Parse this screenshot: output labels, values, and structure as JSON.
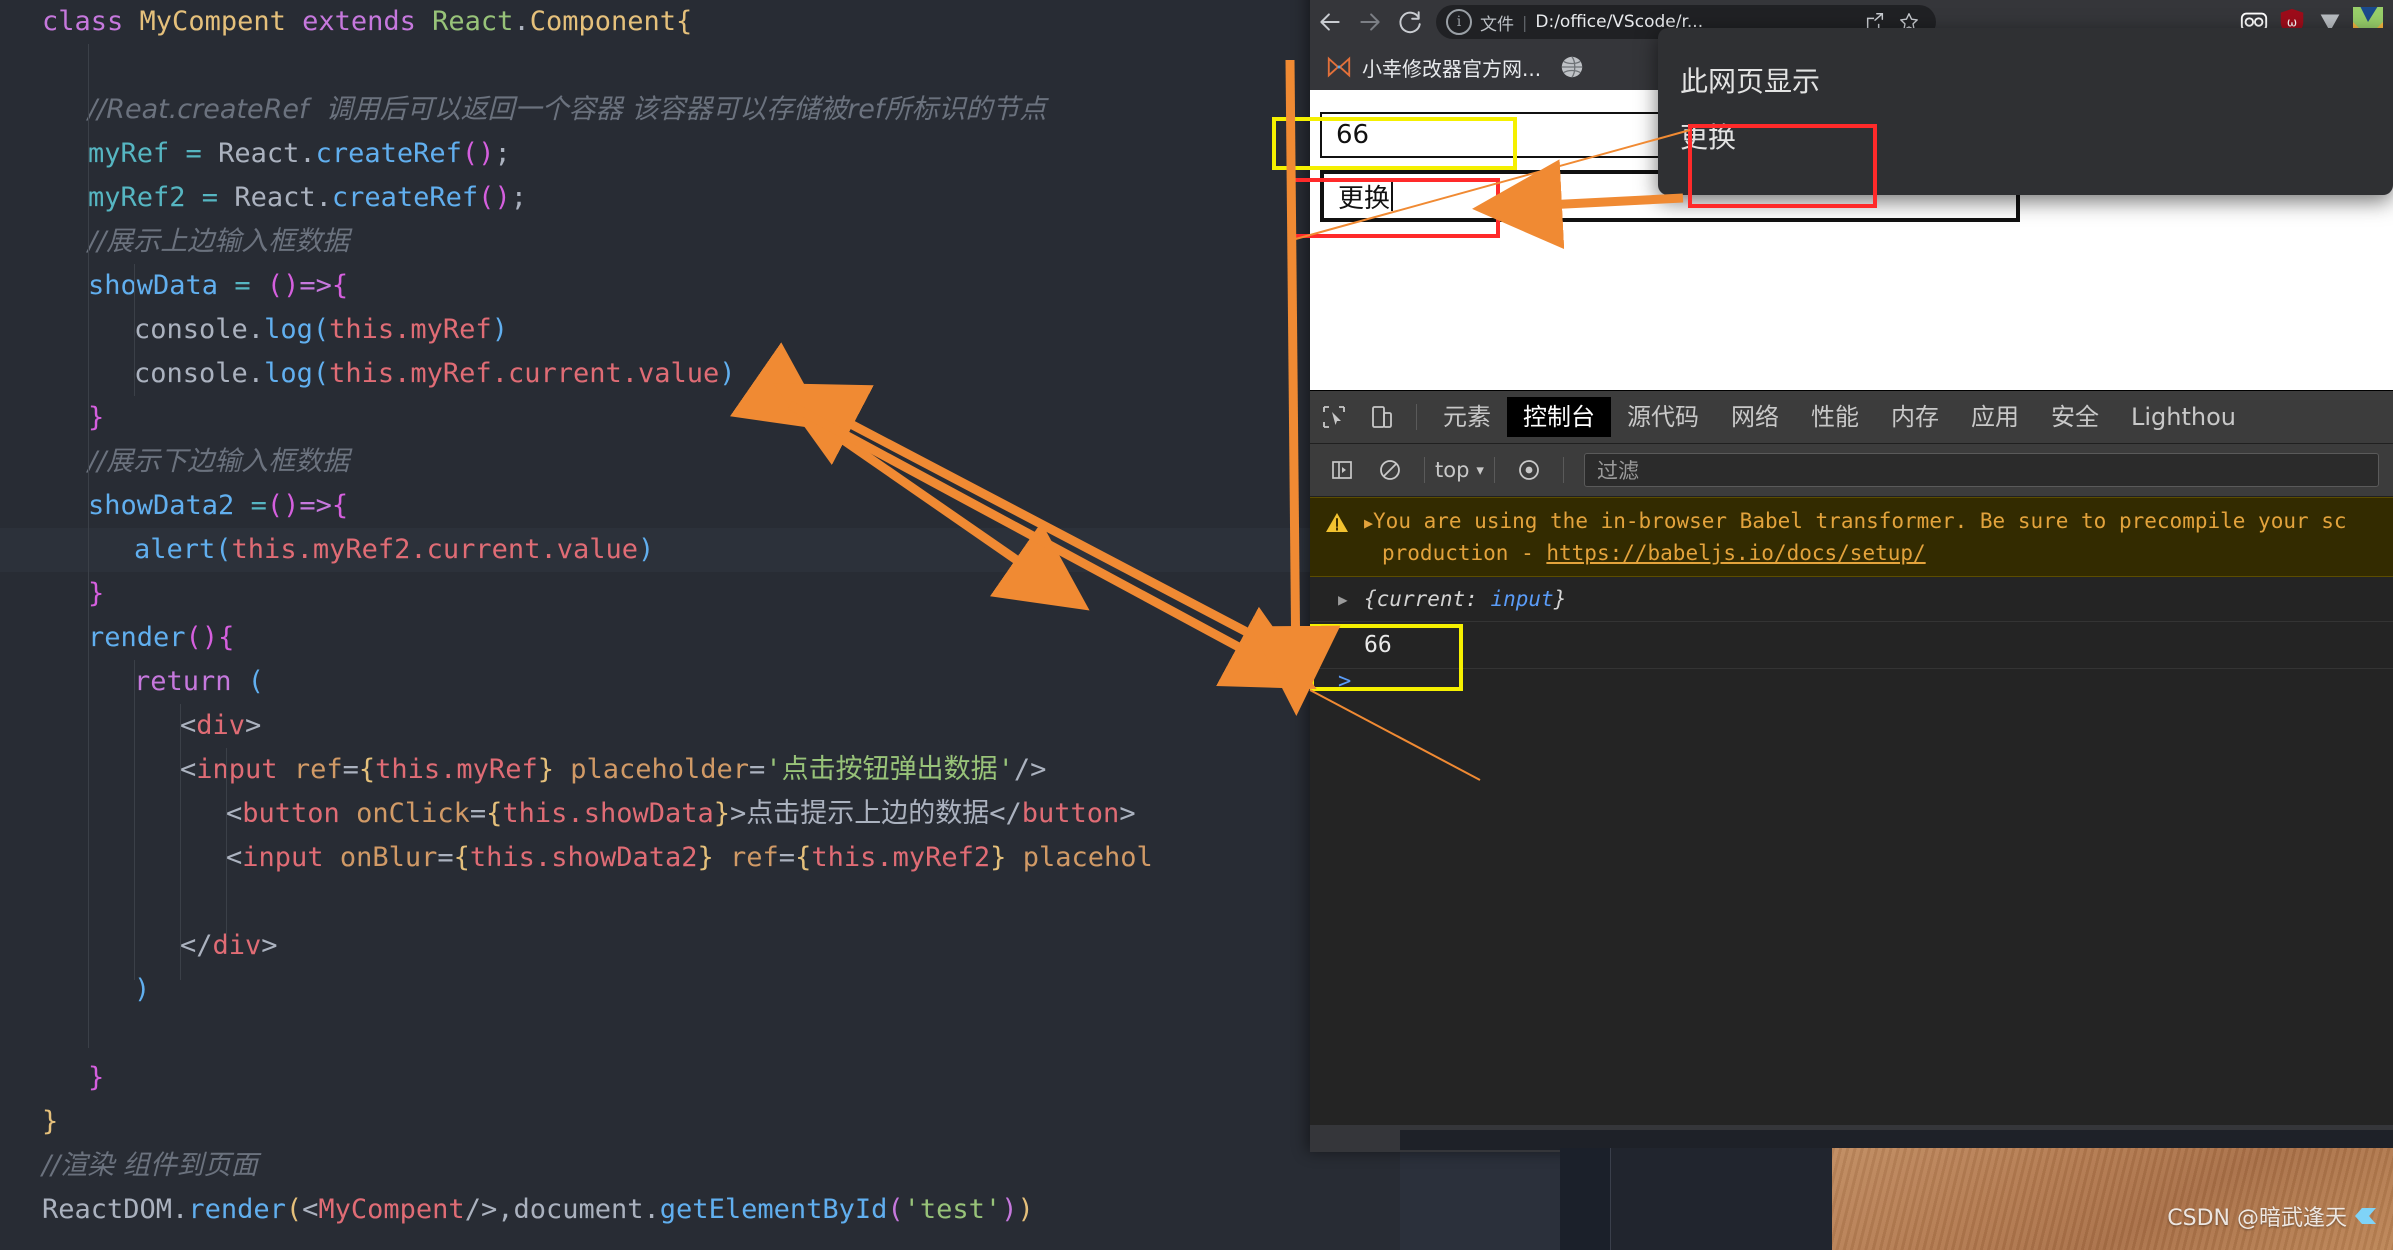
{
  "editor": {
    "lines": [
      {
        "indent": 0,
        "tokens": [
          {
            "t": "class ",
            "c": "k"
          },
          {
            "t": "MyCompent ",
            "c": "yel"
          },
          {
            "t": "extends ",
            "c": "k"
          },
          {
            "t": "React",
            "c": "str"
          },
          {
            "t": ".",
            "c": "gry"
          },
          {
            "t": "Component",
            "c": "yel"
          },
          {
            "t": "{",
            "c": "yel"
          }
        ]
      },
      {
        "indent": 0,
        "tokens": []
      },
      {
        "indent": 1,
        "tokens": [
          {
            "t": "//Reat.createRef  调用后可以返回一个容器 该容器可以存储被ref所标识的节点",
            "c": "cmt-cn"
          }
        ]
      },
      {
        "indent": 1,
        "tokens": [
          {
            "t": "myRef ",
            "c": "cyan"
          },
          {
            "t": "= ",
            "c": "prop"
          },
          {
            "t": "React",
            "c": "var"
          },
          {
            "t": ".",
            "c": "gry"
          },
          {
            "t": "createRef",
            "c": "blue"
          },
          {
            "t": "(",
            "c": "pink"
          },
          {
            "t": ")",
            "c": "pink"
          },
          {
            "t": ";",
            "c": "gry"
          }
        ]
      },
      {
        "indent": 1,
        "tokens": [
          {
            "t": "myRef2 ",
            "c": "cyan"
          },
          {
            "t": "= ",
            "c": "prop"
          },
          {
            "t": "React",
            "c": "var"
          },
          {
            "t": ".",
            "c": "gry"
          },
          {
            "t": "createRef",
            "c": "blue"
          },
          {
            "t": "(",
            "c": "pink"
          },
          {
            "t": ")",
            "c": "pink"
          },
          {
            "t": ";",
            "c": "gry"
          }
        ]
      },
      {
        "indent": 1,
        "tokens": [
          {
            "t": "//展示上边输入框数据",
            "c": "cmt-cn"
          }
        ]
      },
      {
        "indent": 1,
        "tokens": [
          {
            "t": "showData ",
            "c": "blue"
          },
          {
            "t": "= ",
            "c": "prop"
          },
          {
            "t": "(",
            "c": "pink"
          },
          {
            "t": ")",
            "c": "pink"
          },
          {
            "t": "=>",
            "c": "mag"
          },
          {
            "t": "{",
            "c": "pink"
          }
        ]
      },
      {
        "indent": 2,
        "tokens": [
          {
            "t": "console",
            "c": "gry"
          },
          {
            "t": ".",
            "c": "gry"
          },
          {
            "t": "log",
            "c": "blue"
          },
          {
            "t": "(",
            "c": "blue"
          },
          {
            "t": "this",
            "c": "red"
          },
          {
            "t": ".",
            "c": "red"
          },
          {
            "t": "myRef",
            "c": "red"
          },
          {
            "t": ")",
            "c": "blue"
          }
        ]
      },
      {
        "indent": 2,
        "tokens": [
          {
            "t": "console",
            "c": "gry"
          },
          {
            "t": ".",
            "c": "gry"
          },
          {
            "t": "log",
            "c": "blue"
          },
          {
            "t": "(",
            "c": "blue"
          },
          {
            "t": "this",
            "c": "red"
          },
          {
            "t": ".",
            "c": "red"
          },
          {
            "t": "myRef",
            "c": "red"
          },
          {
            "t": ".",
            "c": "red"
          },
          {
            "t": "current",
            "c": "red"
          },
          {
            "t": ".",
            "c": "red"
          },
          {
            "t": "value",
            "c": "red"
          },
          {
            "t": ")",
            "c": "blue"
          }
        ]
      },
      {
        "indent": 1,
        "tokens": [
          {
            "t": "}",
            "c": "pink"
          }
        ]
      },
      {
        "indent": 1,
        "tokens": [
          {
            "t": "//展示下边输入框数据",
            "c": "cmt-cn"
          }
        ]
      },
      {
        "indent": 1,
        "tokens": [
          {
            "t": "showData2 ",
            "c": "blue"
          },
          {
            "t": "=",
            "c": "prop"
          },
          {
            "t": "(",
            "c": "pink"
          },
          {
            "t": ")",
            "c": "pink"
          },
          {
            "t": "=>",
            "c": "mag"
          },
          {
            "t": "{",
            "c": "pink"
          }
        ]
      },
      {
        "indent": 2,
        "hl": true,
        "tokens": [
          {
            "t": "alert",
            "c": "blue"
          },
          {
            "t": "(",
            "c": "blue"
          },
          {
            "t": "this",
            "c": "red"
          },
          {
            "t": ".",
            "c": "red"
          },
          {
            "t": "myRef2",
            "c": "red"
          },
          {
            "t": ".",
            "c": "red"
          },
          {
            "t": "current",
            "c": "red"
          },
          {
            "t": ".",
            "c": "red"
          },
          {
            "t": "value",
            "c": "red"
          },
          {
            "t": ")",
            "c": "blue"
          }
        ]
      },
      {
        "indent": 1,
        "tokens": [
          {
            "t": "}",
            "c": "pink"
          }
        ]
      },
      {
        "indent": 1,
        "tokens": [
          {
            "t": "render",
            "c": "blue"
          },
          {
            "t": "(",
            "c": "pink"
          },
          {
            "t": ")",
            "c": "pink"
          },
          {
            "t": "{",
            "c": "pink"
          }
        ]
      },
      {
        "indent": 2,
        "tokens": [
          {
            "t": "return ",
            "c": "mag"
          },
          {
            "t": "(",
            "c": "blue"
          }
        ]
      },
      {
        "indent": 3,
        "tokens": [
          {
            "t": "<",
            "c": "gry"
          },
          {
            "t": "div",
            "c": "red"
          },
          {
            "t": ">",
            "c": "gry"
          }
        ]
      },
      {
        "indent": 3,
        "tokens": [
          {
            "t": "<",
            "c": "gry"
          },
          {
            "t": "input ",
            "c": "red"
          },
          {
            "t": "ref",
            "c": "org"
          },
          {
            "t": "=",
            "c": "gry"
          },
          {
            "t": "{",
            "c": "yel"
          },
          {
            "t": "this",
            "c": "red"
          },
          {
            "t": ".",
            "c": "red"
          },
          {
            "t": "myRef",
            "c": "red"
          },
          {
            "t": "}",
            "c": "yel"
          },
          {
            "t": " placeholder",
            "c": "org"
          },
          {
            "t": "=",
            "c": "gry"
          },
          {
            "t": "'",
            "c": "str"
          },
          {
            "t": "点击按钮弹出数据",
            "c": "cnstr"
          },
          {
            "t": "'",
            "c": "str"
          },
          {
            "t": "/>",
            "c": "gry"
          }
        ]
      },
      {
        "indent": 4,
        "tokens": [
          {
            "t": "<",
            "c": "gry"
          },
          {
            "t": "button ",
            "c": "red"
          },
          {
            "t": "onClick",
            "c": "org"
          },
          {
            "t": "=",
            "c": "gry"
          },
          {
            "t": "{",
            "c": "yel"
          },
          {
            "t": "this",
            "c": "red"
          },
          {
            "t": ".",
            "c": "red"
          },
          {
            "t": "showData",
            "c": "red"
          },
          {
            "t": "}",
            "c": "yel"
          },
          {
            "t": ">",
            "c": "gry"
          },
          {
            "t": "点击提示上边的数据",
            "c": "cn"
          },
          {
            "t": "</",
            "c": "gry"
          },
          {
            "t": "button",
            "c": "red"
          },
          {
            "t": ">",
            "c": "gry"
          }
        ]
      },
      {
        "indent": 4,
        "tokens": [
          {
            "t": "<",
            "c": "gry"
          },
          {
            "t": "input ",
            "c": "red"
          },
          {
            "t": "onBlur",
            "c": "org"
          },
          {
            "t": "=",
            "c": "gry"
          },
          {
            "t": "{",
            "c": "yel"
          },
          {
            "t": "this",
            "c": "red"
          },
          {
            "t": ".",
            "c": "red"
          },
          {
            "t": "showData2",
            "c": "red"
          },
          {
            "t": "}",
            "c": "yel"
          },
          {
            "t": " ref",
            "c": "org"
          },
          {
            "t": "=",
            "c": "gry"
          },
          {
            "t": "{",
            "c": "yel"
          },
          {
            "t": "this",
            "c": "red"
          },
          {
            "t": ".",
            "c": "red"
          },
          {
            "t": "myRef2",
            "c": "red"
          },
          {
            "t": "}",
            "c": "yel"
          },
          {
            "t": " placehol",
            "c": "org"
          }
        ]
      },
      {
        "indent": 0,
        "tokens": []
      },
      {
        "indent": 3,
        "tokens": [
          {
            "t": "</",
            "c": "gry"
          },
          {
            "t": "div",
            "c": "red"
          },
          {
            "t": ">",
            "c": "gry"
          }
        ]
      },
      {
        "indent": 2,
        "tokens": [
          {
            "t": ")",
            "c": "blue"
          }
        ]
      },
      {
        "indent": 0,
        "tokens": []
      },
      {
        "indent": 1,
        "tokens": [
          {
            "t": "}",
            "c": "pink"
          }
        ]
      },
      {
        "indent": 0,
        "tokens": [
          {
            "t": "}",
            "c": "yel"
          }
        ]
      },
      {
        "indent": 0,
        "tokens": [
          {
            "t": "//渲染 组件到页面",
            "c": "cmt-cn"
          }
        ]
      },
      {
        "indent": 0,
        "tokens": [
          {
            "t": "ReactDOM",
            "c": "gry"
          },
          {
            "t": ".",
            "c": "gry"
          },
          {
            "t": "render",
            "c": "blue"
          },
          {
            "t": "(",
            "c": "yel"
          },
          {
            "t": "<",
            "c": "gry"
          },
          {
            "t": "MyCompent",
            "c": "red"
          },
          {
            "t": "/>",
            "c": "gry"
          },
          {
            "t": ",",
            "c": "gry"
          },
          {
            "t": "document",
            "c": "gry"
          },
          {
            "t": ".",
            "c": "gry"
          },
          {
            "t": "getElementById",
            "c": "blue"
          },
          {
            "t": "(",
            "c": "mag"
          },
          {
            "t": "'test'",
            "c": "str"
          },
          {
            "t": ")",
            "c": "mag"
          },
          {
            "t": ")",
            "c": "yel"
          }
        ]
      }
    ]
  },
  "browser": {
    "nav": {
      "back_icon": "arrow-left-icon",
      "forward_icon": "arrow-right-icon",
      "reload_icon": "reload-icon"
    },
    "omnibox": {
      "info_icon": "info-circle-icon",
      "scheme_label": "文件",
      "url": "D:/office/VScode/r...",
      "share_icon": "share-icon",
      "bookmark_icon": "star-icon"
    },
    "extensions": [
      {
        "name": "binoculars-extension-icon"
      },
      {
        "name": "shield-extension-icon"
      },
      {
        "name": "download-arrow-icon"
      },
      {
        "name": "colorful-extension-icon"
      }
    ],
    "bookmarks": [
      {
        "icon": "bowtie-bookmark-icon",
        "label": "小幸修改器官方网..."
      },
      {
        "icon": "globe-bookmark-icon",
        "label": ""
      }
    ],
    "page": {
      "input_top_value": "66",
      "input_bottom_value": "更换"
    }
  },
  "modal": {
    "title": "此网页显示",
    "message": "更换"
  },
  "devtools": {
    "inspect_icon": "inspect-cursor-icon",
    "device_icon": "device-toolbar-icon",
    "tabs": [
      {
        "label": "元素",
        "active": false
      },
      {
        "label": "控制台",
        "active": true
      },
      {
        "label": "源代码",
        "active": false
      },
      {
        "label": "网络",
        "active": false
      },
      {
        "label": "性能",
        "active": false
      },
      {
        "label": "内存",
        "active": false
      },
      {
        "label": "应用",
        "active": false
      },
      {
        "label": "安全",
        "active": false
      },
      {
        "label": "Lighthou",
        "active": false
      }
    ],
    "toolbar": {
      "sidebar_icon": "console-sidebar-icon",
      "clear_icon": "clear-console-icon",
      "context_label": "top",
      "context_caret": "chevron-down-icon",
      "eye_icon": "live-expression-icon",
      "filter_placeholder": "过滤"
    },
    "console": {
      "warning_icon": "warning-triangle-icon",
      "warning_expand_icon": "expand-triangle-icon",
      "warning_line1": "You are using the in-browser Babel transformer. Be sure to precompile your sc",
      "warning_line2_prefix": "production - ",
      "warning_link": "https://babeljs.io/docs/setup/",
      "log_expand_icon": "expand-triangle-icon",
      "log_object": "{current: input}",
      "log_object_key": "current",
      "log_object_value": "input",
      "output_value": "66",
      "prompt_icon": "console-prompt-icon"
    }
  },
  "annotations": {
    "highlight_color_yellow": "#f5f000",
    "highlight_color_red": "#ff2a2a",
    "arrow_color": "#f08a33"
  },
  "watermark": {
    "text": "CSDN @暗武逢天"
  }
}
